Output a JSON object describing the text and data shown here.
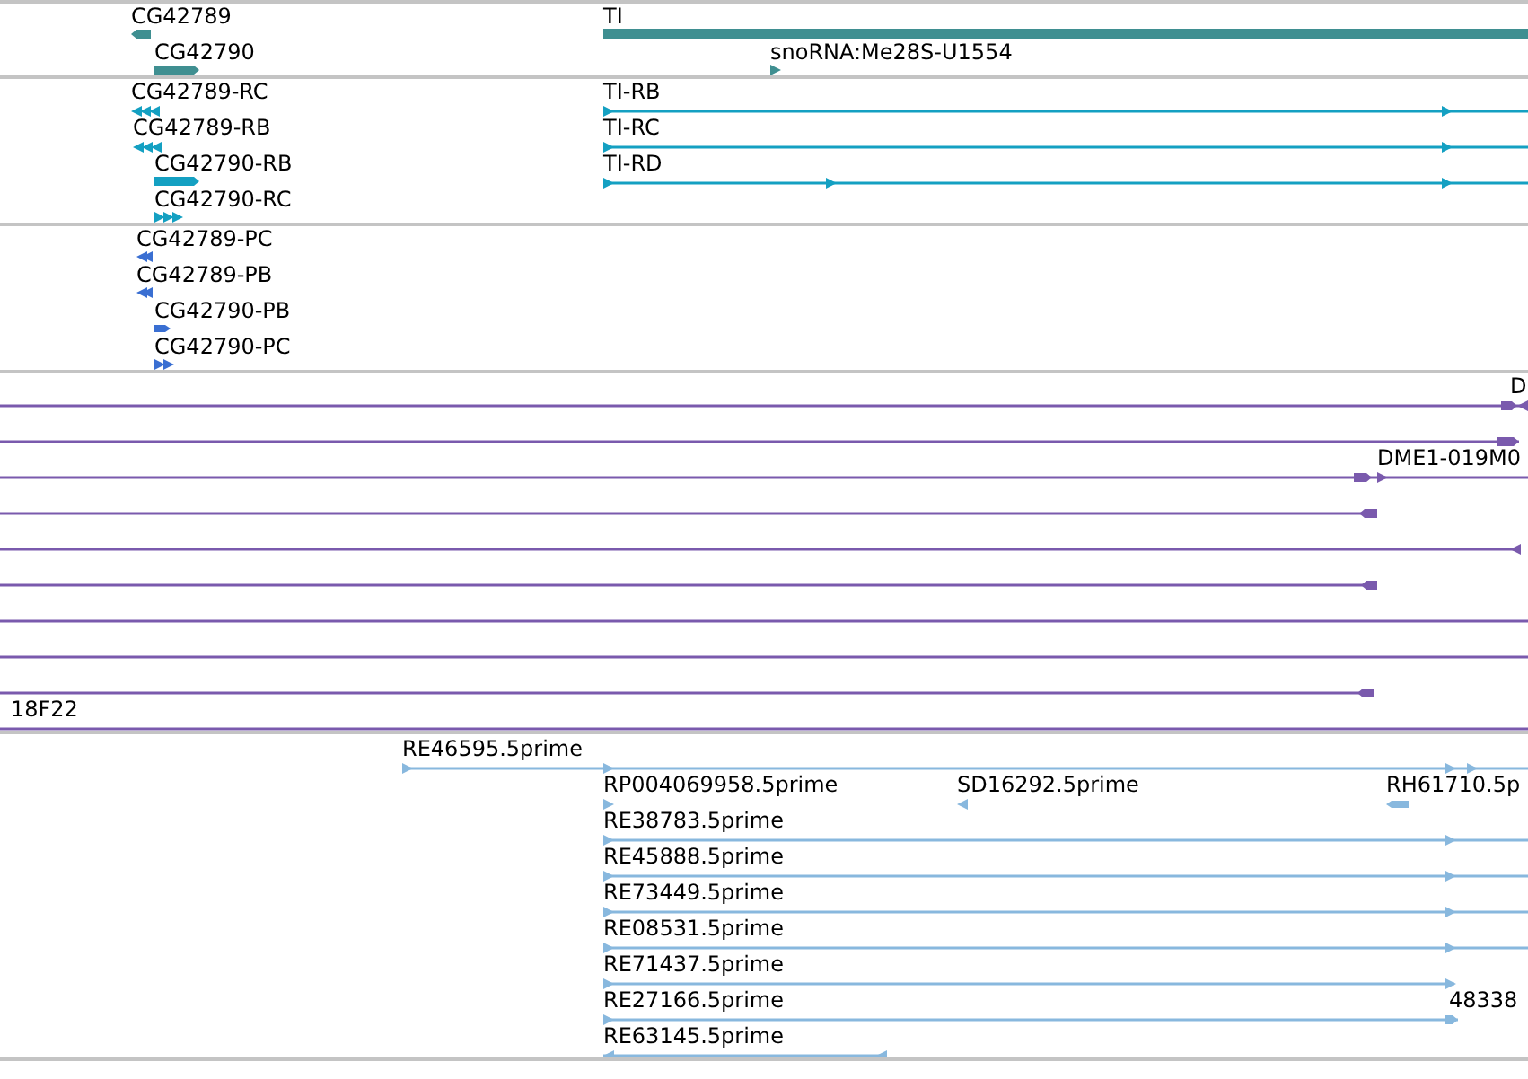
{
  "tracks": [
    {
      "color": "#3f8f91",
      "features": [
        {
          "label": "CG42789"
        },
        {
          "label": "CG42790"
        },
        {
          "label": "TI"
        },
        {
          "label": "snoRNA:Me28S-U1554"
        }
      ]
    },
    {
      "color": "#14a0c2",
      "features": [
        {
          "label": "CG42789-RC"
        },
        {
          "label": "CG42789-RB"
        },
        {
          "label": "CG42790-RB"
        },
        {
          "label": "CG42790-RC"
        },
        {
          "label": "TI-RB"
        },
        {
          "label": "TI-RC"
        },
        {
          "label": "TI-RD"
        }
      ]
    },
    {
      "color": "#3a6fd2",
      "features": [
        {
          "label": "CG42789-PC"
        },
        {
          "label": "CG42789-PB"
        },
        {
          "label": "CG42790-PB"
        },
        {
          "label": "CG42790-PC"
        }
      ]
    },
    {
      "color": "#7a5aad",
      "features": [
        {
          "label": "D"
        },
        {
          "label": "DME1-019M0"
        },
        {
          "label": "18F22"
        }
      ]
    },
    {
      "color": "#88b8de",
      "features": [
        {
          "label": "RE46595.5prime"
        },
        {
          "label": "RP004069958.5prime"
        },
        {
          "label": "SD16292.5prime"
        },
        {
          "label": "RH61710.5p"
        },
        {
          "label": "RE38783.5prime"
        },
        {
          "label": "RE45888.5prime"
        },
        {
          "label": "RE73449.5prime"
        },
        {
          "label": "RE08531.5prime"
        },
        {
          "label": "RE71437.5prime"
        },
        {
          "label": "RE27166.5prime"
        },
        {
          "label": "48338"
        },
        {
          "label": "RE63145.5prime"
        }
      ]
    }
  ]
}
